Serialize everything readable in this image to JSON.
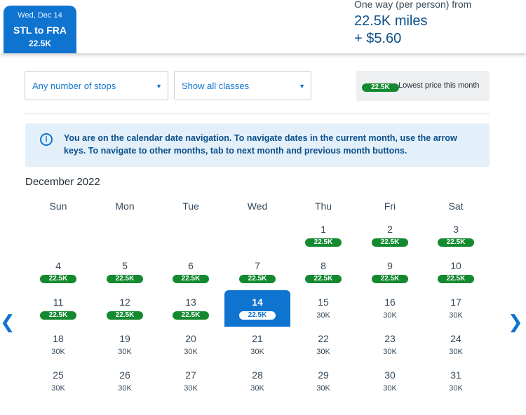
{
  "trip_tab": {
    "date": "Wed, Dec 14",
    "route": "STL to FRA",
    "miles": "22.5K"
  },
  "fare": {
    "label": "One way (per person) from",
    "miles": "22.5K miles",
    "fee": "+ $5.60"
  },
  "filters": {
    "stops": "Any number of stops",
    "classes": "Show all classes"
  },
  "legend": {
    "badge": "22.5K",
    "text": "Lowest price this month"
  },
  "info": {
    "text": "You are on the calendar date navigation. To navigate dates in the current month, use the arrow keys. To navigate to other months, tab to next month and previous month buttons."
  },
  "calendar": {
    "month": "December 2022",
    "weekdays": [
      "Sun",
      "Mon",
      "Tue",
      "Wed",
      "Thu",
      "Fri",
      "Sat"
    ],
    "first_weekday_index": 4,
    "selected_day": 14,
    "days": [
      {
        "day": "1",
        "price": "22.5K",
        "lowest": true
      },
      {
        "day": "2",
        "price": "22.5K",
        "lowest": true
      },
      {
        "day": "3",
        "price": "22.5K",
        "lowest": true
      },
      {
        "day": "4",
        "price": "22.5K",
        "lowest": true
      },
      {
        "day": "5",
        "price": "22.5K",
        "lowest": true
      },
      {
        "day": "6",
        "price": "22.5K",
        "lowest": true
      },
      {
        "day": "7",
        "price": "22.5K",
        "lowest": true
      },
      {
        "day": "8",
        "price": "22.5K",
        "lowest": true
      },
      {
        "day": "9",
        "price": "22.5K",
        "lowest": true
      },
      {
        "day": "10",
        "price": "22.5K",
        "lowest": true
      },
      {
        "day": "11",
        "price": "22.5K",
        "lowest": true
      },
      {
        "day": "12",
        "price": "22.5K",
        "lowest": true
      },
      {
        "day": "13",
        "price": "22.5K",
        "lowest": true
      },
      {
        "day": "14",
        "price": "22.5K",
        "lowest": true
      },
      {
        "day": "15",
        "price": "30K",
        "lowest": false
      },
      {
        "day": "16",
        "price": "30K",
        "lowest": false
      },
      {
        "day": "17",
        "price": "30K",
        "lowest": false
      },
      {
        "day": "18",
        "price": "30K",
        "lowest": false
      },
      {
        "day": "19",
        "price": "30K",
        "lowest": false
      },
      {
        "day": "20",
        "price": "30K",
        "lowest": false
      },
      {
        "day": "21",
        "price": "30K",
        "lowest": false
      },
      {
        "day": "22",
        "price": "30K",
        "lowest": false
      },
      {
        "day": "23",
        "price": "30K",
        "lowest": false
      },
      {
        "day": "24",
        "price": "30K",
        "lowest": false
      },
      {
        "day": "25",
        "price": "30K",
        "lowest": false
      },
      {
        "day": "26",
        "price": "30K",
        "lowest": false
      },
      {
        "day": "27",
        "price": "30K",
        "lowest": false
      },
      {
        "day": "28",
        "price": "30K",
        "lowest": false
      },
      {
        "day": "29",
        "price": "30K",
        "lowest": false
      },
      {
        "day": "30",
        "price": "30K",
        "lowest": false
      },
      {
        "day": "31",
        "price": "30K",
        "lowest": false
      }
    ]
  },
  "icons": {
    "info": "info-circle-icon",
    "caret": "caret-down-icon",
    "prev": "chevron-left-icon",
    "next": "chevron-right-icon"
  },
  "colors": {
    "primary": "#0f73d0",
    "lowest_badge": "#138a2f",
    "info_bg": "#e3f0fa"
  }
}
